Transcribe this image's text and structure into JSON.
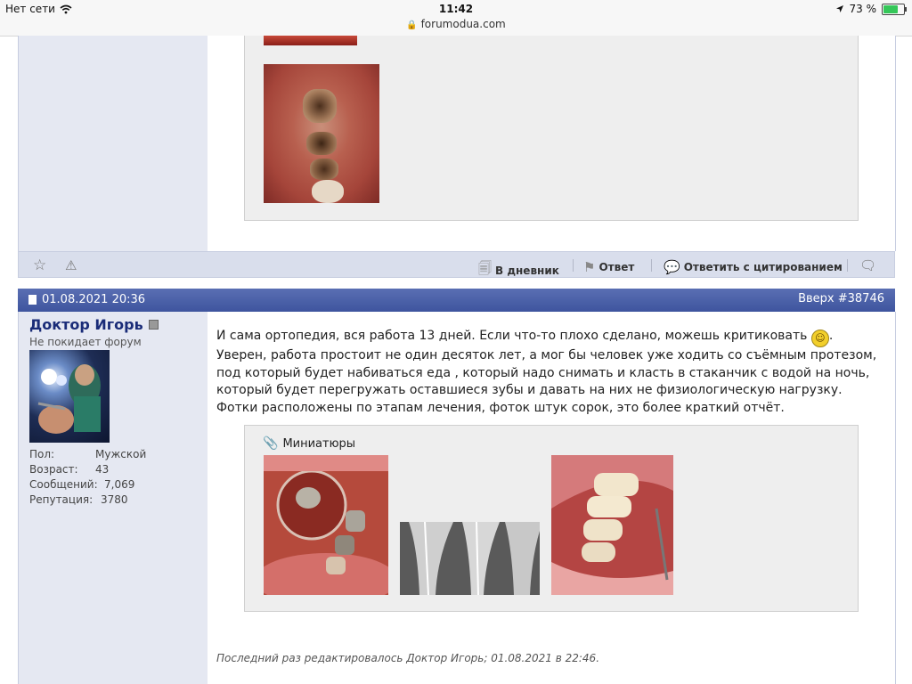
{
  "statusbar": {
    "network": "Нет сети",
    "time": "11:42",
    "url": "forumodua.com",
    "battery": "73 %",
    "battery_level": 0.73
  },
  "post1": {
    "toolbar": {
      "diary_label": "В дневник",
      "reply_label": "Ответ",
      "quote_label": "Ответить с цитированием"
    }
  },
  "post2": {
    "date": "01.08.2021 20:36",
    "top_link": "Вверх",
    "post_number": "#38746",
    "user": {
      "name": "Доктор Игорь",
      "title": "Не покидает форум",
      "fields": [
        {
          "label": "Пол:",
          "value": "Мужской"
        },
        {
          "label": "Возраст:",
          "value": "43"
        },
        {
          "label": "Сообщений:",
          "value": "7,069"
        },
        {
          "label": "Репутация:",
          "value": "3780"
        }
      ]
    },
    "message_part1": "И сама ортопедия, вся работа 13 дней. Если что-то плохо сделано, можешь критиковать ",
    "message_part2": ". Уверен, работа простоит не один десяток лет, а мог бы человек уже ходить со съёмным протезом, под который будет набиваться еда , который надо снимать и класть в стаканчик с водой на ночь, который будет перегружать оставшиеся зубы и давать на них не физиологическую нагрузку. Фотки расположены по этапам лечения, фоток штук сорок, это более краткий отчёт.",
    "attachments_title": "Миниатюры",
    "edited": "Последний раз редактировалось Доктор Игорь; 01.08.2021 в 22:46."
  },
  "colors": {
    "header_bar": "#4a60a8",
    "sidebar_bg": "#e5e8f2",
    "username": "#1a2c78",
    "battery_fill": "#35c759"
  },
  "icons": [
    "wifi-icon",
    "location-icon",
    "battery-icon",
    "lock-icon",
    "star-icon",
    "warning-icon",
    "diary-icon",
    "reply-icon",
    "quote-icon",
    "multiquote-icon",
    "post-icon",
    "online-status-icon",
    "paperclip-icon",
    "smiley-icon"
  ]
}
